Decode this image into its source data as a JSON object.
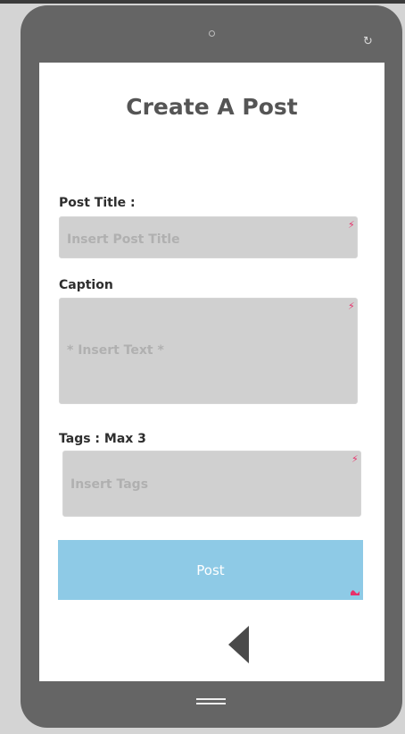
{
  "device": {
    "rotate_icon": "rotate-icon",
    "menu_icon": "hamburger-menu-icon"
  },
  "form": {
    "title": "Create A Post",
    "post_title_label": "Post Title :",
    "post_title_placeholder": "Insert Post Title",
    "caption_label": "Caption",
    "caption_placeholder": "* Insert Text *",
    "tags_label": "Tags : Max 3",
    "tags_placeholder": "Insert Tags",
    "post_button": "Post"
  },
  "colors": {
    "button": "#8ecae6",
    "field": "#d0d0d0",
    "marker": "#e8306a"
  }
}
